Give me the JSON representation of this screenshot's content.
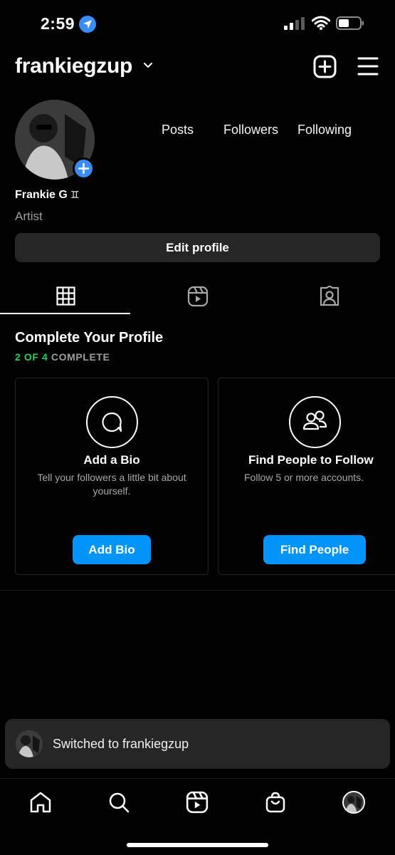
{
  "status_bar": {
    "time": "2:59",
    "icons": [
      "location-arrow-icon",
      "signal-icon",
      "wifi-icon",
      "battery-icon"
    ]
  },
  "header": {
    "username": "frankiegzup",
    "icons": [
      "chevron-down-icon",
      "new-post-icon",
      "menu-icon"
    ]
  },
  "profile": {
    "stats": {
      "posts_label": "Posts",
      "followers_label": "Followers",
      "following_label": "Following"
    },
    "display_name": "Frankie G",
    "pronoun_symbol": "♊",
    "category": "Artist",
    "edit_button": "Edit profile"
  },
  "tabs": [
    {
      "icon": "grid-icon",
      "active": true
    },
    {
      "icon": "reels-icon",
      "active": false
    },
    {
      "icon": "tagged-icon",
      "active": false
    }
  ],
  "complete_profile": {
    "title": "Complete Your Profile",
    "progress_done": "2 OF 4",
    "progress_suffix": "COMPLETE",
    "cards": [
      {
        "icon": "speech-bubble-icon",
        "title": "Add a Bio",
        "description": "Tell your followers a little bit about yourself.",
        "button": "Add Bio"
      },
      {
        "icon": "people-icon",
        "title": "Find People to Follow",
        "description": "Follow 5 or more accounts.",
        "button": "Find People"
      }
    ]
  },
  "toast": {
    "text": "Switched to frankiegzup"
  },
  "bottom_nav": [
    "home-icon",
    "search-icon",
    "reels-icon",
    "shop-icon",
    "profile-avatar"
  ],
  "colors": {
    "background": "#000000",
    "accent_blue": "#0095f6",
    "progress_green": "#2fcd5f",
    "surface": "#262626"
  }
}
